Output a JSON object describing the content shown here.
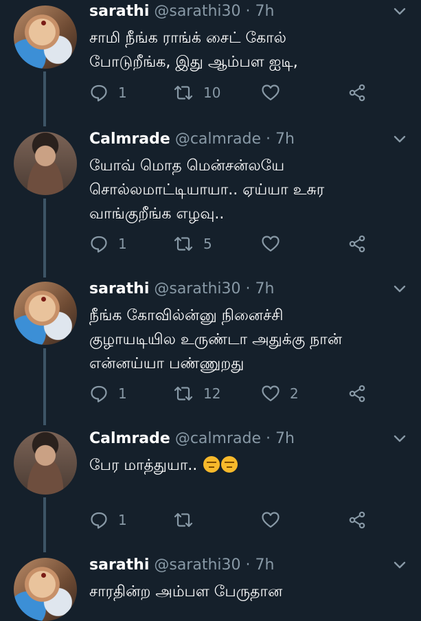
{
  "tweets": [
    {
      "name": "sarathi",
      "handle": "@sarathi30",
      "separator": "·",
      "time": "7h",
      "avatar": "child",
      "lines": [
        "சாமி நீங்க ராங்க்  சைட் கோல்",
        "போடுறீங்க, இது ஆம்பள ஐடி,"
      ],
      "reply_count": "1",
      "retweet_count": "10",
      "like_count": ""
    },
    {
      "name": "Calmrade",
      "handle": "@calmrade",
      "separator": "·",
      "time": "7h",
      "avatar": "man",
      "lines": [
        "யோவ் மொத மென்சன்லயே",
        "சொல்லமாட்டியாயா.. ஏய்யா உசுர",
        "வாங்குறீங்க எழவு.."
      ],
      "reply_count": "1",
      "retweet_count": "5",
      "like_count": ""
    },
    {
      "name": "sarathi",
      "handle": "@sarathi30",
      "separator": "·",
      "time": "7h",
      "avatar": "child",
      "lines": [
        "நீங்க கோவில்ன்னு நினைச்சி",
        "குழாயடியில உருண்டா அதுக்கு நான்",
        "என்னய்யா பண்ணுறது"
      ],
      "reply_count": "1",
      "retweet_count": "12",
      "like_count": "2"
    },
    {
      "name": "Calmrade",
      "handle": "@calmrade",
      "separator": "·",
      "time": "7h",
      "avatar": "man",
      "lines": [
        "பேர மாத்துயா.."
      ],
      "emoji": "unamused-face-icon",
      "reply_count": "1",
      "retweet_count": "",
      "like_count": ""
    },
    {
      "name": "sarathi",
      "handle": "@sarathi30",
      "separator": "·",
      "time": "7h",
      "avatar": "child",
      "lines": [
        "சாரதின்ற அம்பள பேருதான"
      ],
      "reply_count": "",
      "retweet_count": "",
      "like_count": ""
    }
  ],
  "colors": {
    "background": "#15202b",
    "secondary_text": "#8899a6",
    "thread_line": "#3d5466"
  }
}
